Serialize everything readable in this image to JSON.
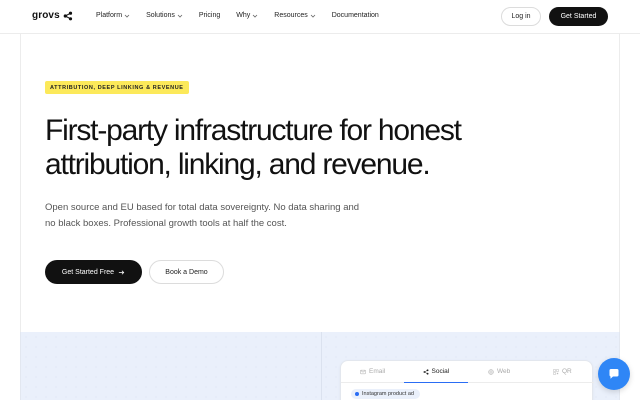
{
  "header": {
    "logo_text": "grovs",
    "nav": [
      {
        "label": "Platform",
        "has_dropdown": true
      },
      {
        "label": "Solutions",
        "has_dropdown": true
      },
      {
        "label": "Pricing",
        "has_dropdown": false
      },
      {
        "label": "Why",
        "has_dropdown": true
      },
      {
        "label": "Resources",
        "has_dropdown": true
      },
      {
        "label": "Documentation",
        "has_dropdown": false
      }
    ],
    "login_label": "Log in",
    "get_started_label": "Get Started"
  },
  "hero": {
    "badge": "ATTRIBUTION, DEEP LINKING & REVENUE",
    "headline_line1": "First-party infrastructure for honest",
    "headline_line2": "attribution, linking, and revenue.",
    "subtext_line1": "Open source and EU based for total data sovereignty. No data sharing and",
    "subtext_line2": "no black boxes. Professional growth tools at half the cost.",
    "cta_primary": "Get Started Free",
    "cta_secondary": "Book a Demo"
  },
  "demo_card": {
    "tabs": [
      {
        "label": "Email",
        "icon": "mail-icon",
        "active": false
      },
      {
        "label": "Social",
        "icon": "share-icon",
        "active": true
      },
      {
        "label": "Web",
        "icon": "globe-icon",
        "active": false
      },
      {
        "label": "QR",
        "icon": "qr-icon",
        "active": false
      }
    ],
    "chip_label": "Instagram product ad"
  },
  "colors": {
    "accent": "#2a6df4",
    "badge_bg": "#fce95a",
    "dark": "#111111",
    "chat_fab": "#2f86f6"
  }
}
